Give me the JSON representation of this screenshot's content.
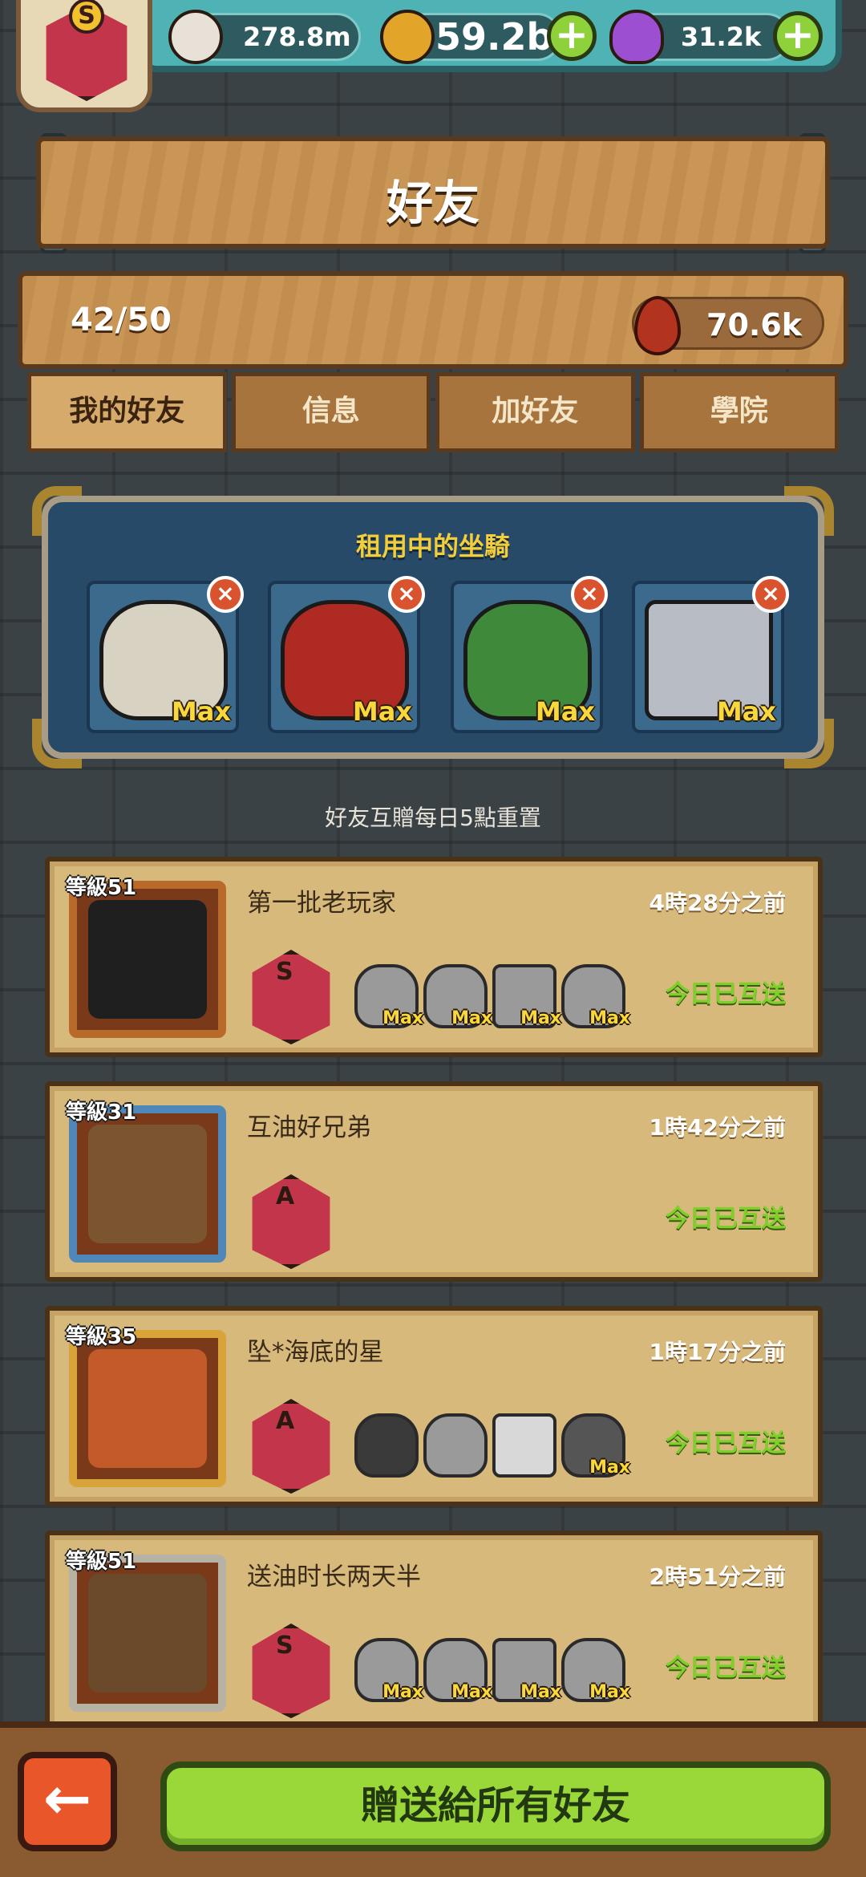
{
  "header": {
    "rank_letter": "S",
    "resources": [
      {
        "name": "eyeball",
        "value": "278.8m",
        "icon": "eyeball-icon",
        "color": "#e8e1d8"
      },
      {
        "name": "coin",
        "value": "59.2b",
        "icon": "coin-icon",
        "color": "#e2a52a"
      },
      {
        "name": "potion",
        "value": "31.2k",
        "icon": "potion-icon",
        "color": "#9c4fd0"
      }
    ]
  },
  "title": "好友",
  "friend_count": "42/50",
  "blood_value": "70.6k",
  "tabs": [
    {
      "label": "我的好友",
      "active": true
    },
    {
      "label": "信息",
      "active": false
    },
    {
      "label": "加好友",
      "active": false
    },
    {
      "label": "學院",
      "active": false
    }
  ],
  "rented_mounts": {
    "title": "租用中的坐騎",
    "slots": [
      {
        "max_label": "Max",
        "color": "#d8d2c2"
      },
      {
        "max_label": "Max",
        "color": "#b02a24"
      },
      {
        "max_label": "Max",
        "color": "#3f8a3a"
      },
      {
        "max_label": "Max",
        "color": "#b8bcc4"
      }
    ]
  },
  "reset_note": "好友互贈每日5點重置",
  "friends": [
    {
      "level": "等級51",
      "name": "第一批老玩家",
      "time": "4時28分之前",
      "status": "今日已互送",
      "rank": "S",
      "rank_color": "#c2354a",
      "frame_color": "#b86a2a",
      "avatar_color": "#1f1f1f",
      "mounts": [
        {
          "max": "Max"
        },
        {
          "max": "Max"
        },
        {
          "max": "Max"
        },
        {
          "max": "Max"
        }
      ]
    },
    {
      "level": "等級31",
      "name": "互油好兄弟",
      "time": "1時42分之前",
      "status": "今日已互送",
      "rank": "A",
      "rank_color": "#c2354a",
      "frame_color": "#4f88b8",
      "avatar_color": "#7a5530",
      "mounts": []
    },
    {
      "level": "等級35",
      "name": "坠*海底的星",
      "time": "1時17分之前",
      "status": "今日已互送",
      "rank": "A",
      "rank_color": "#c2354a",
      "frame_color": "#d8a43a",
      "avatar_color": "#c45a2a",
      "mounts": [
        {
          "max": ""
        },
        {
          "max": ""
        },
        {
          "max": ""
        },
        {
          "max": "Max"
        }
      ]
    },
    {
      "level": "等級51",
      "name": "送油时长两天半",
      "time": "2時51分之前",
      "status": "今日已互送",
      "rank": "S",
      "rank_color": "#c2354a",
      "frame_color": "#b8b2a4",
      "avatar_color": "#6a4a2a",
      "mounts": [
        {
          "max": "Max"
        },
        {
          "max": "Max"
        },
        {
          "max": "Max"
        },
        {
          "max": "Max"
        }
      ]
    }
  ],
  "footer": {
    "back_icon": "back-arrow-icon",
    "send_all_label": "贈送給所有好友"
  }
}
